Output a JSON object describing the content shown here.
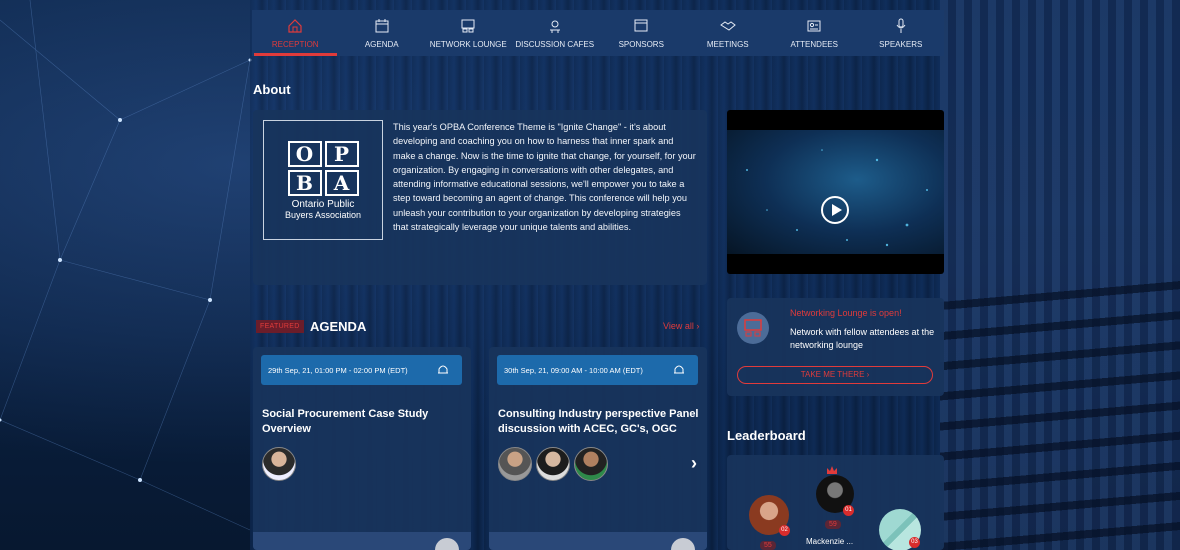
{
  "nav": {
    "items": [
      {
        "label": "RECEPTION",
        "icon": "home-icon",
        "active": true
      },
      {
        "label": "AGENDA",
        "icon": "calendar-icon",
        "active": false
      },
      {
        "label": "NETWORK LOUNGE",
        "icon": "lounge-icon",
        "active": false
      },
      {
        "label": "DISCUSSION CAFES",
        "icon": "cafe-icon",
        "active": false
      },
      {
        "label": "SPONSORS",
        "icon": "sponsor-icon",
        "active": false
      },
      {
        "label": "MEETINGS",
        "icon": "handshake-icon",
        "active": false
      },
      {
        "label": "ATTENDEES",
        "icon": "id-card-icon",
        "active": false
      },
      {
        "label": "SPEAKERS",
        "icon": "microphone-icon",
        "active": false
      }
    ]
  },
  "about": {
    "title": "About",
    "logo_letters": [
      "O",
      "P",
      "B",
      "A"
    ],
    "logo_line1": "Ontario Public",
    "logo_line2": "Buyers Association",
    "text": "This year's OPBA Conference Theme is \"Ignite Change\" - it's about developing and coaching you on how to harness that inner spark and make a change. Now is the time to ignite that change, for yourself, for your organization. By engaging in conversations with other delegates, and attending informative educational sessions, we'll empower you to take a step toward becoming an agent of change. This conference will help you unleash your contribution to your organization by developing strategies that strategically leverage your unique talents and abilities."
  },
  "agenda": {
    "badge": "FEATURED",
    "title": "AGENDA",
    "view_all": "View all",
    "cards": [
      {
        "date": "29th Sep, 21, 01:00 PM - 02:00 PM (EDT)",
        "title": "Social Procurement Case Study Overview"
      },
      {
        "date": "30th Sep, 21, 09:00 AM - 10:00 AM (EDT)",
        "title": "Consulting Industry perspective Panel discussion with ACEC, GC's, OGC"
      }
    ]
  },
  "lounge": {
    "heading": "Networking Lounge is open!",
    "text": "Network with fellow attendees at the networking lounge",
    "button": "TAKE ME THERE"
  },
  "leaderboard": {
    "title": "Leaderboard",
    "entries": [
      {
        "rank": "01",
        "points": "59",
        "name": "Mackenzie ..."
      },
      {
        "rank": "02",
        "points": "55",
        "name": ""
      },
      {
        "rank": "03",
        "points": "",
        "name": ""
      }
    ]
  },
  "colors": {
    "accent": "#e03b3b",
    "nav_bg": "#1a3a6a",
    "card_bg": "#18345c",
    "pill_bg": "#1d6aab"
  }
}
